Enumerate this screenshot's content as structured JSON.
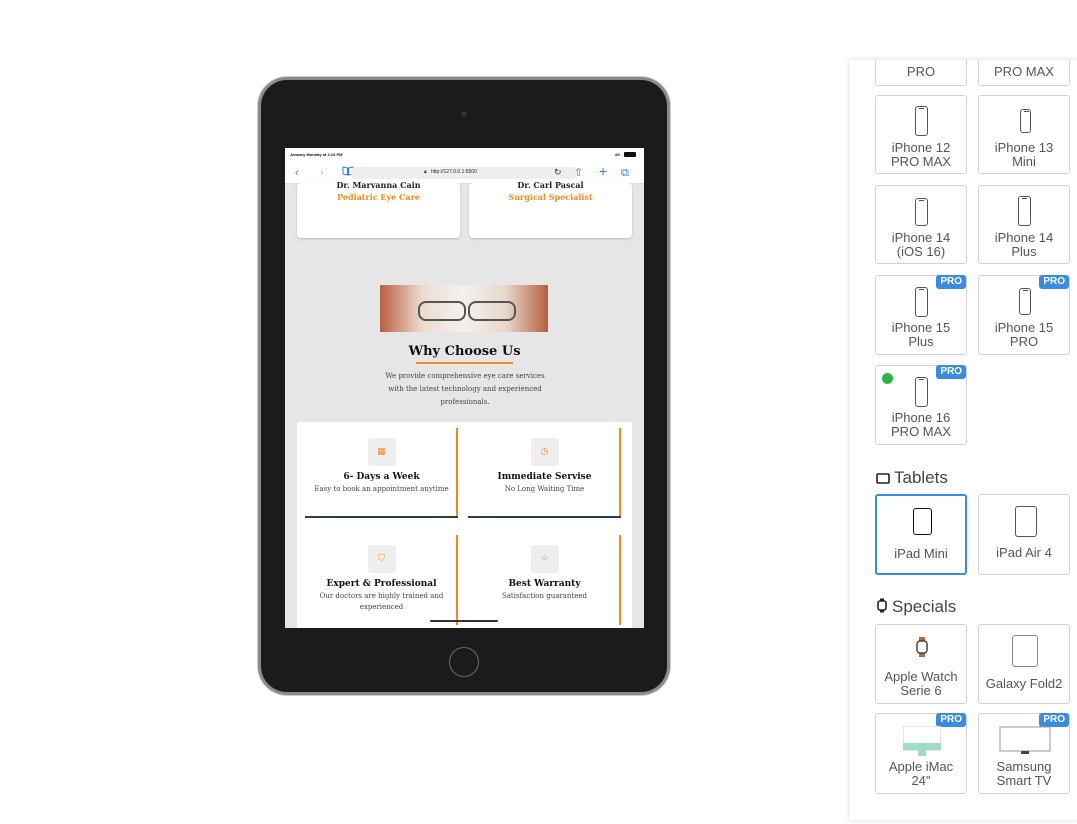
{
  "browser": {
    "status_time": "January Monday at 4:23 PM",
    "status_signal": "4G",
    "back": "‹",
    "forward": "›",
    "book": "📖",
    "aa": "AA",
    "url": "http://127.0.0.1:5500",
    "reload": "↻",
    "share": "⇧",
    "plus": "+",
    "tabs": "⧉"
  },
  "page": {
    "doctors": [
      {
        "name": "Dr. Maryanna Cain",
        "specialty": "Pediatric Eye Care"
      },
      {
        "name": "Dr. Carl Pascal",
        "specialty": "Surgical Specialist"
      }
    ],
    "why_title": "Why Choose Us",
    "why_desc": "We provide comprehensive eye care services with the latest technology and experienced professionals.",
    "features": [
      {
        "icon": "calendar-icon",
        "glyph": "▦",
        "title": "6- Days a Week",
        "desc": "Easy to book an appointment anytime"
      },
      {
        "icon": "clock-icon",
        "glyph": "◷",
        "title": "Immediate Servise",
        "desc": "No Long Waiting Time"
      },
      {
        "icon": "shield-icon",
        "glyph": "⛉",
        "title": "Expert & Professional",
        "desc": "Our doctors are highly trained and experienced"
      },
      {
        "icon": "star-icon",
        "glyph": "☆",
        "title": "Best Warranty",
        "desc": "Satisfaction guaranteed"
      }
    ]
  },
  "panel": {
    "partial_top": [
      "PRO",
      "PRO MAX"
    ],
    "phones": [
      {
        "label1": "iPhone 12",
        "label2": "PRO MAX",
        "pro": false
      },
      {
        "label1": "iPhone 13",
        "label2": "Mini",
        "pro": false
      },
      {
        "label1": "iPhone 14",
        "label2": "(iOS 16)",
        "pro": false
      },
      {
        "label1": "iPhone 14",
        "label2": "Plus",
        "pro": false
      },
      {
        "label1": "iPhone 15",
        "label2": "Plus",
        "pro": true
      },
      {
        "label1": "iPhone 15",
        "label2": "PRO",
        "pro": true
      },
      {
        "label1": "iPhone 16",
        "label2": "PRO MAX",
        "pro": true,
        "active": true
      }
    ],
    "pro_badge": "PRO",
    "tablets_heading": "Tablets",
    "tablets": [
      {
        "label": "iPad Mini",
        "selected": true
      },
      {
        "label": "iPad Air 4",
        "selected": false
      }
    ],
    "specials_heading": "Specials",
    "specials": [
      {
        "label1": "Apple Watch",
        "label2": "Serie 6",
        "pro": false
      },
      {
        "label1": "Galaxy Fold2",
        "label2": "",
        "pro": false
      },
      {
        "label1": "Apple iMac",
        "label2": "24\"",
        "pro": true
      },
      {
        "label1": "Samsung",
        "label2": "Smart TV",
        "pro": true
      }
    ],
    "accent_color": "#3b8ce0"
  }
}
